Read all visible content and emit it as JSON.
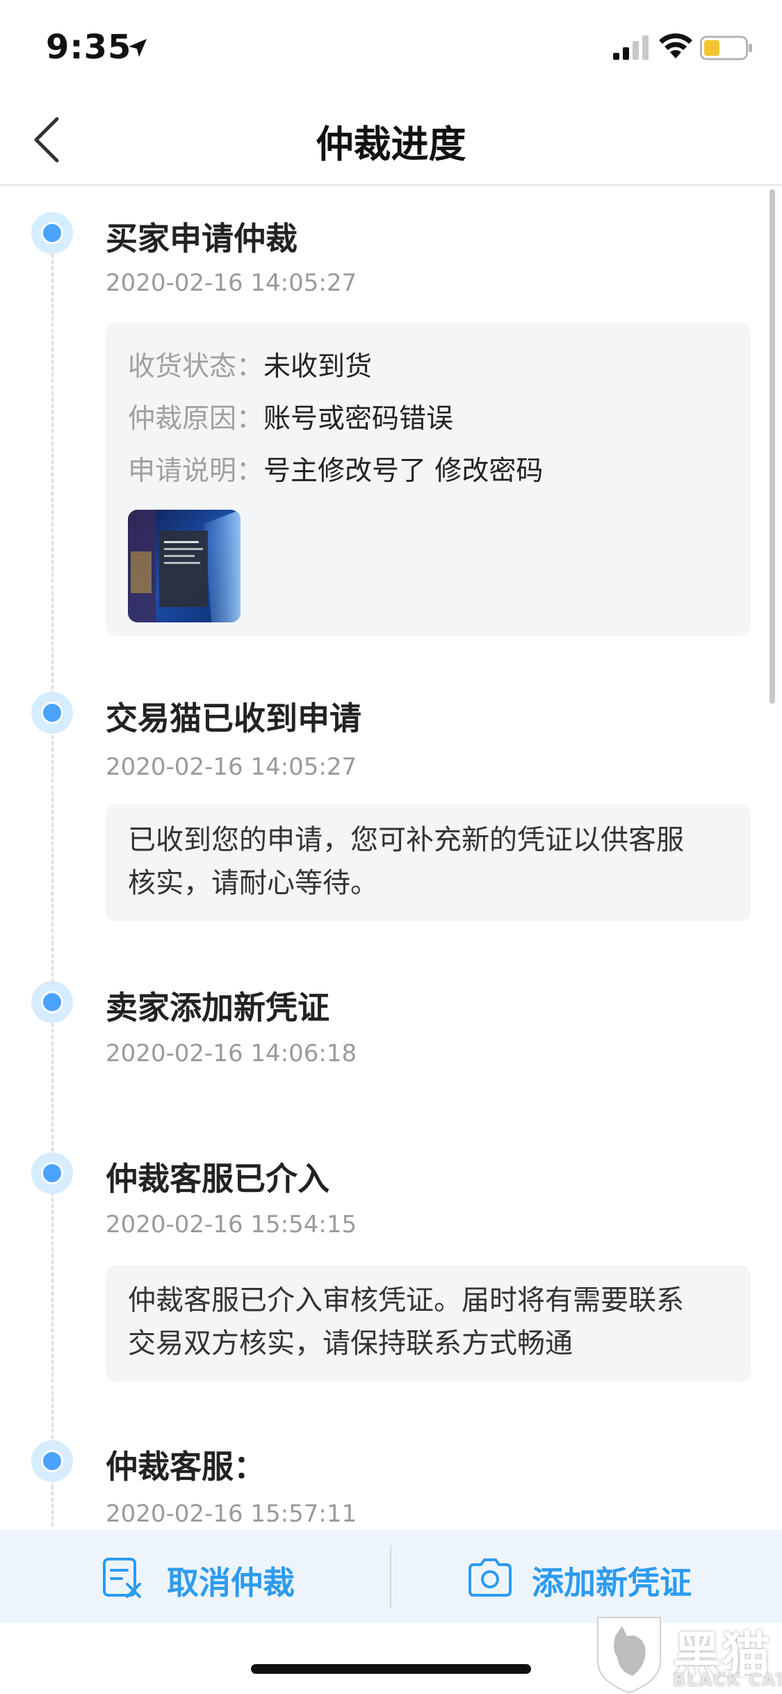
{
  "status_bar": {
    "time": "9:35"
  },
  "nav": {
    "title": "仲裁进度"
  },
  "timeline": [
    {
      "title": "买家申请仲裁",
      "date": "2020-02-16 14:05:27",
      "details": [
        {
          "label": "收货状态：",
          "value": "未收到货"
        },
        {
          "label": "仲裁原因：",
          "value": "账号或密码错误"
        },
        {
          "label": "申请说明：",
          "value": "号主修改号了 修改密码"
        }
      ]
    },
    {
      "title": "交易猫已收到申请",
      "date": "2020-02-16 14:05:27",
      "note_lines": [
        "已收到您的申请，您可补充新的凭证以供客服",
        "核实，请耐心等待。"
      ]
    },
    {
      "title": "卖家添加新凭证",
      "date": "2020-02-16 14:06:18"
    },
    {
      "title": "仲裁客服已介入",
      "date": "2020-02-16 15:54:15",
      "note_lines": [
        "仲裁客服已介入审核凭证。届时将有需要联系",
        "交易双方核实，请保持联系方式畅通"
      ]
    },
    {
      "title": "仲裁客服：",
      "date": "2020-02-16 15:57:11"
    }
  ],
  "actions": {
    "cancel_label": "取消仲裁",
    "add_label": "添加新凭证"
  },
  "watermark": {
    "text": "黑猫",
    "sub": "BLACK CAT"
  },
  "colors": {
    "accent": "#2c9bf0",
    "dot": "#4aa3ff",
    "card_bg": "#f4f5f7",
    "bottom_bg": "#eef4fb"
  }
}
